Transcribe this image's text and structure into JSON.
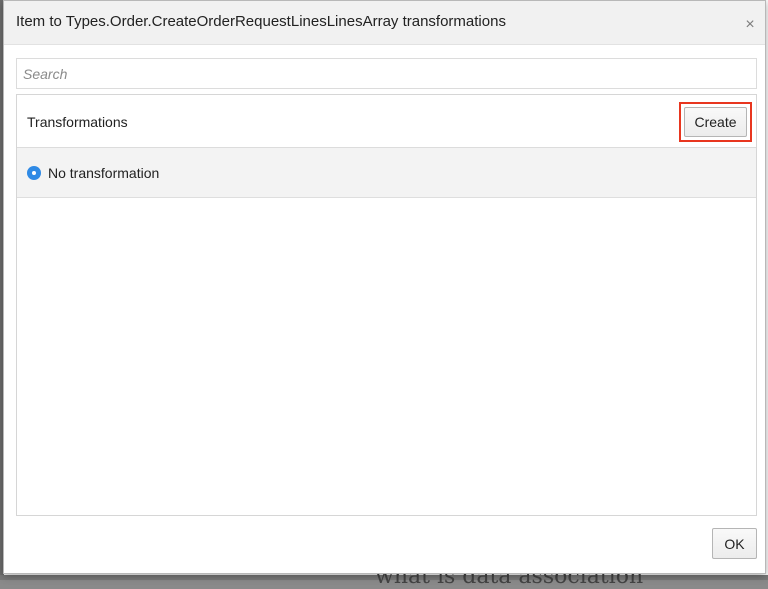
{
  "dialog": {
    "title": "Item to Types.Order.CreateOrderRequestLinesLinesArray transformations",
    "close_icon": "close-icon",
    "close_glyph": "×"
  },
  "search": {
    "placeholder": "Search",
    "value": ""
  },
  "transformations": {
    "title": "Transformations",
    "create_label": "Create",
    "options": [
      {
        "label": "No transformation",
        "selected": true
      }
    ]
  },
  "footer": {
    "ok_label": "OK"
  },
  "background": {
    "partial_text": "what is data association"
  },
  "colors": {
    "highlight": "#e8361f",
    "radio_selected": "#2f8ae5"
  }
}
